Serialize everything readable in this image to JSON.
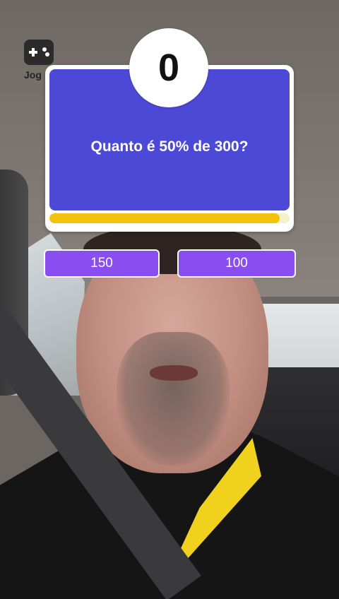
{
  "app": {
    "label": "Jog",
    "icon": "gamepad-icon"
  },
  "quiz": {
    "score": "0",
    "question": "Quanto é 50% de 300?",
    "timer_progress": 0.96,
    "answers": [
      {
        "label": "150"
      },
      {
        "label": "100"
      }
    ]
  },
  "colors": {
    "card_blue": "#4c49d6",
    "answer_purple": "#8a4df0",
    "progress_yellow": "#f4c20d"
  }
}
